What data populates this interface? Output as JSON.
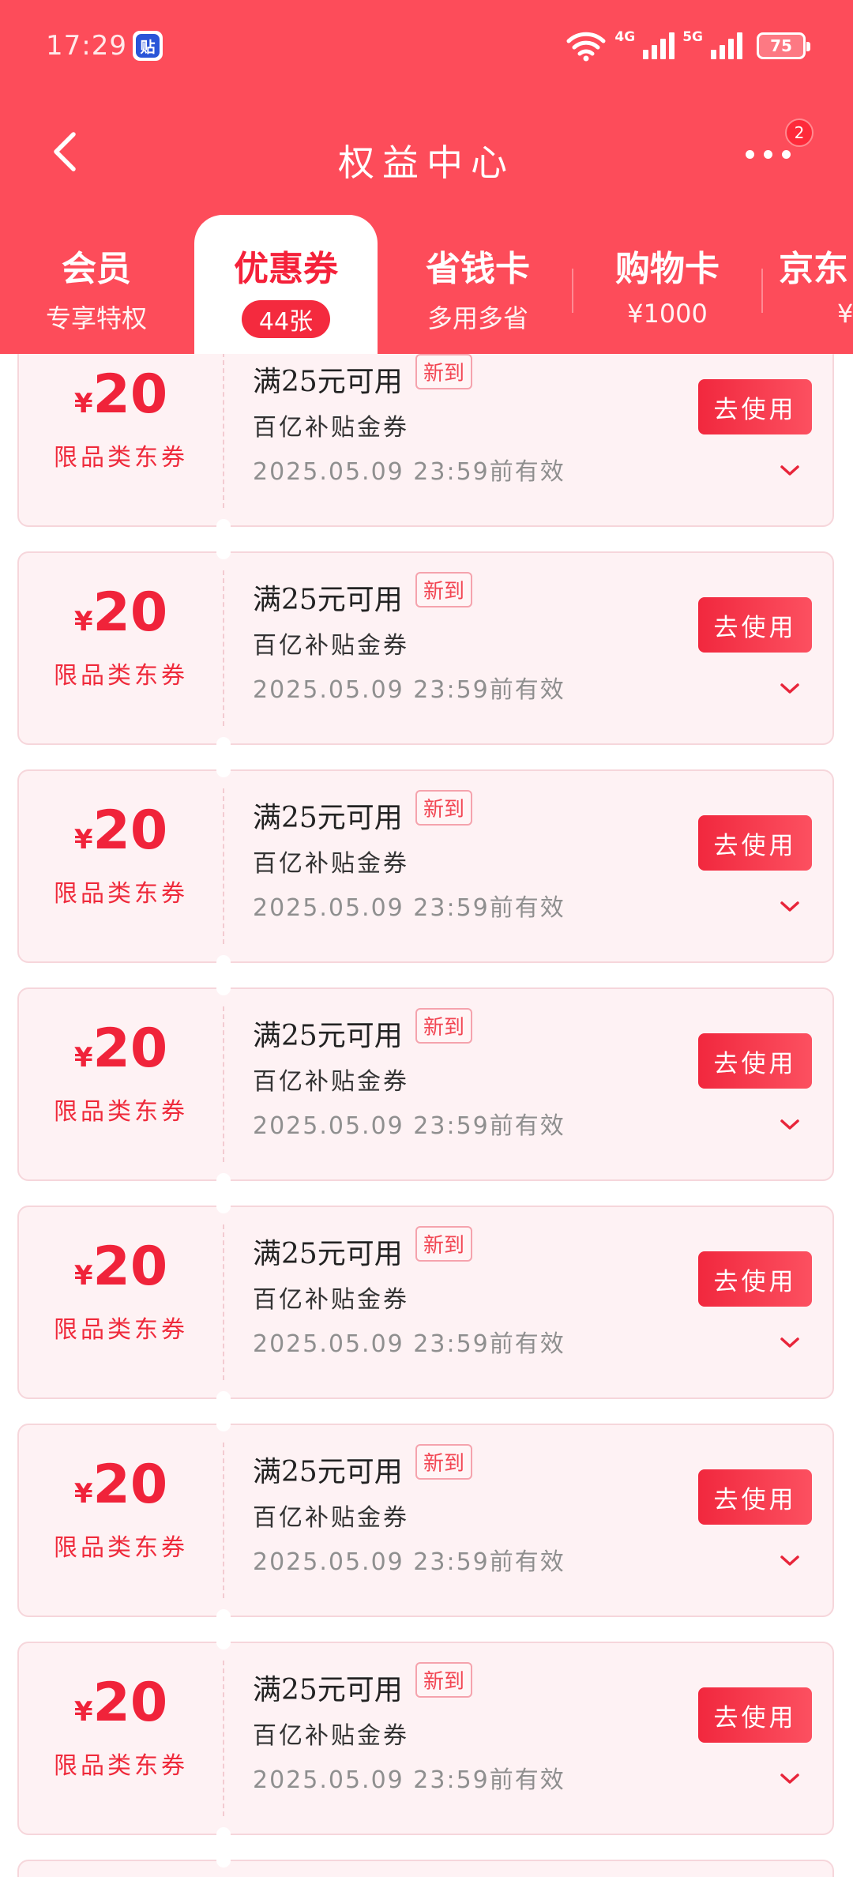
{
  "status_bar": {
    "time": "17:29",
    "app_icon_char": "贴",
    "net1": "4G",
    "net2": "5G",
    "battery": "75"
  },
  "nav": {
    "title": "权益中心",
    "more_badge": "2"
  },
  "tabs": [
    {
      "title": "会员",
      "sub": "专享特权"
    },
    {
      "title": "优惠券",
      "sub": "44张"
    },
    {
      "title": "省钱卡",
      "sub": "多用多省"
    },
    {
      "title": "购物卡",
      "sub": "¥1000"
    },
    {
      "title": "京东",
      "sub": "¥"
    }
  ],
  "coupons": [
    {
      "currency": "¥",
      "amount": "20",
      "type": "限品类东券",
      "condition": "满25元可用",
      "tag": "新到",
      "name": "百亿补贴金券",
      "expiry": "2025.05.09 23:59前有效",
      "button": "去使用"
    },
    {
      "currency": "¥",
      "amount": "20",
      "type": "限品类东券",
      "condition": "满25元可用",
      "tag": "新到",
      "name": "百亿补贴金券",
      "expiry": "2025.05.09 23:59前有效",
      "button": "去使用"
    },
    {
      "currency": "¥",
      "amount": "20",
      "type": "限品类东券",
      "condition": "满25元可用",
      "tag": "新到",
      "name": "百亿补贴金券",
      "expiry": "2025.05.09 23:59前有效",
      "button": "去使用"
    },
    {
      "currency": "¥",
      "amount": "20",
      "type": "限品类东券",
      "condition": "满25元可用",
      "tag": "新到",
      "name": "百亿补贴金券",
      "expiry": "2025.05.09 23:59前有效",
      "button": "去使用"
    },
    {
      "currency": "¥",
      "amount": "20",
      "type": "限品类东券",
      "condition": "满25元可用",
      "tag": "新到",
      "name": "百亿补贴金券",
      "expiry": "2025.05.09 23:59前有效",
      "button": "去使用"
    },
    {
      "currency": "¥",
      "amount": "20",
      "type": "限品类东券",
      "condition": "满25元可用",
      "tag": "新到",
      "name": "百亿补贴金券",
      "expiry": "2025.05.09 23:59前有效",
      "button": "去使用"
    },
    {
      "currency": "¥",
      "amount": "20",
      "type": "限品类东券",
      "condition": "满25元可用",
      "tag": "新到",
      "name": "百亿补贴金券",
      "expiry": "2025.05.09 23:59前有效",
      "button": "去使用"
    }
  ],
  "colors": {
    "header": "#fd4c5a",
    "accent": "#f0233a",
    "coupon_bg": "#fef2f4"
  },
  "icons": {
    "back": "chevron-left-icon",
    "more": "more-dots-icon",
    "expand": "chevron-down-icon",
    "wifi": "wifi-icon",
    "signal": "signal-icon",
    "battery": "battery-icon"
  }
}
